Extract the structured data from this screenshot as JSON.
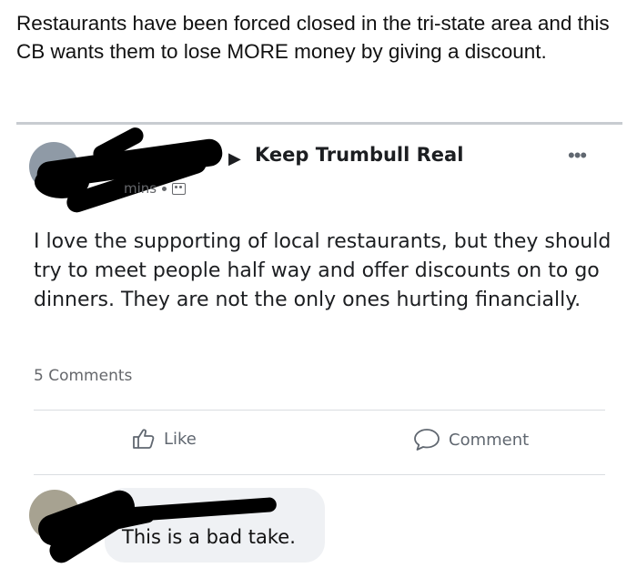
{
  "caption": {
    "text": "Restaurants have been forced closed in the tri-state area and this CB wants them to lose MORE money by giving a discount."
  },
  "post": {
    "arrow": "▶",
    "group_name": "Keep Trumbull Real",
    "more_label": "•••",
    "time": "10 mins",
    "time_visible_fragment": "mins",
    "audience_icon": "group-icon",
    "body": "I love the supporting of local restaurants, but they should try to meet people half way and offer discounts on to go dinners. They are not the only ones hurting financially.",
    "comments_count": "5 Comments",
    "actions": {
      "like_label": "Like",
      "comment_label": "Comment"
    }
  },
  "comment": {
    "text": "This is a bad take."
  },
  "colors": {
    "redaction": "#000000",
    "divider": "#dadde1",
    "muted_text": "#65676b",
    "bubble_bg": "#eff1f4"
  }
}
